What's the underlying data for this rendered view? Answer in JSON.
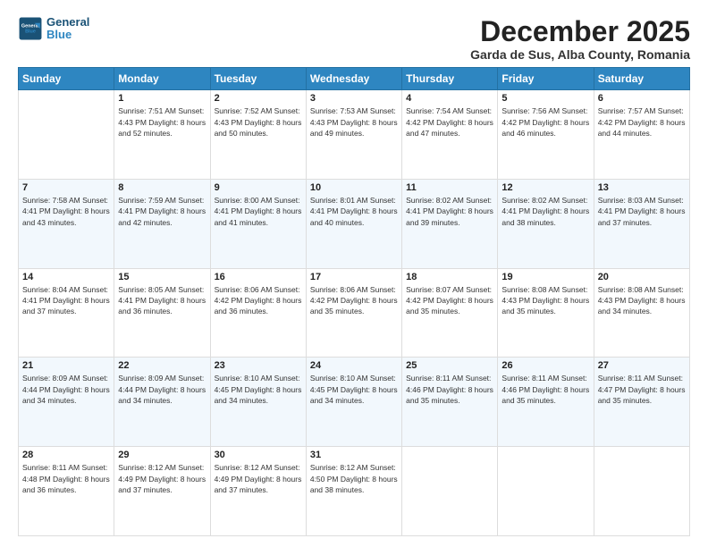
{
  "header": {
    "logo_line1": "General",
    "logo_line2": "Blue",
    "month": "December 2025",
    "location": "Garda de Sus, Alba County, Romania"
  },
  "weekdays": [
    "Sunday",
    "Monday",
    "Tuesday",
    "Wednesday",
    "Thursday",
    "Friday",
    "Saturday"
  ],
  "weeks": [
    [
      {
        "day": "",
        "info": ""
      },
      {
        "day": "1",
        "info": "Sunrise: 7:51 AM\nSunset: 4:43 PM\nDaylight: 8 hours\nand 52 minutes."
      },
      {
        "day": "2",
        "info": "Sunrise: 7:52 AM\nSunset: 4:43 PM\nDaylight: 8 hours\nand 50 minutes."
      },
      {
        "day": "3",
        "info": "Sunrise: 7:53 AM\nSunset: 4:43 PM\nDaylight: 8 hours\nand 49 minutes."
      },
      {
        "day": "4",
        "info": "Sunrise: 7:54 AM\nSunset: 4:42 PM\nDaylight: 8 hours\nand 47 minutes."
      },
      {
        "day": "5",
        "info": "Sunrise: 7:56 AM\nSunset: 4:42 PM\nDaylight: 8 hours\nand 46 minutes."
      },
      {
        "day": "6",
        "info": "Sunrise: 7:57 AM\nSunset: 4:42 PM\nDaylight: 8 hours\nand 44 minutes."
      }
    ],
    [
      {
        "day": "7",
        "info": "Sunrise: 7:58 AM\nSunset: 4:41 PM\nDaylight: 8 hours\nand 43 minutes."
      },
      {
        "day": "8",
        "info": "Sunrise: 7:59 AM\nSunset: 4:41 PM\nDaylight: 8 hours\nand 42 minutes."
      },
      {
        "day": "9",
        "info": "Sunrise: 8:00 AM\nSunset: 4:41 PM\nDaylight: 8 hours\nand 41 minutes."
      },
      {
        "day": "10",
        "info": "Sunrise: 8:01 AM\nSunset: 4:41 PM\nDaylight: 8 hours\nand 40 minutes."
      },
      {
        "day": "11",
        "info": "Sunrise: 8:02 AM\nSunset: 4:41 PM\nDaylight: 8 hours\nand 39 minutes."
      },
      {
        "day": "12",
        "info": "Sunrise: 8:02 AM\nSunset: 4:41 PM\nDaylight: 8 hours\nand 38 minutes."
      },
      {
        "day": "13",
        "info": "Sunrise: 8:03 AM\nSunset: 4:41 PM\nDaylight: 8 hours\nand 37 minutes."
      }
    ],
    [
      {
        "day": "14",
        "info": "Sunrise: 8:04 AM\nSunset: 4:41 PM\nDaylight: 8 hours\nand 37 minutes."
      },
      {
        "day": "15",
        "info": "Sunrise: 8:05 AM\nSunset: 4:41 PM\nDaylight: 8 hours\nand 36 minutes."
      },
      {
        "day": "16",
        "info": "Sunrise: 8:06 AM\nSunset: 4:42 PM\nDaylight: 8 hours\nand 36 minutes."
      },
      {
        "day": "17",
        "info": "Sunrise: 8:06 AM\nSunset: 4:42 PM\nDaylight: 8 hours\nand 35 minutes."
      },
      {
        "day": "18",
        "info": "Sunrise: 8:07 AM\nSunset: 4:42 PM\nDaylight: 8 hours\nand 35 minutes."
      },
      {
        "day": "19",
        "info": "Sunrise: 8:08 AM\nSunset: 4:43 PM\nDaylight: 8 hours\nand 35 minutes."
      },
      {
        "day": "20",
        "info": "Sunrise: 8:08 AM\nSunset: 4:43 PM\nDaylight: 8 hours\nand 34 minutes."
      }
    ],
    [
      {
        "day": "21",
        "info": "Sunrise: 8:09 AM\nSunset: 4:44 PM\nDaylight: 8 hours\nand 34 minutes."
      },
      {
        "day": "22",
        "info": "Sunrise: 8:09 AM\nSunset: 4:44 PM\nDaylight: 8 hours\nand 34 minutes."
      },
      {
        "day": "23",
        "info": "Sunrise: 8:10 AM\nSunset: 4:45 PM\nDaylight: 8 hours\nand 34 minutes."
      },
      {
        "day": "24",
        "info": "Sunrise: 8:10 AM\nSunset: 4:45 PM\nDaylight: 8 hours\nand 34 minutes."
      },
      {
        "day": "25",
        "info": "Sunrise: 8:11 AM\nSunset: 4:46 PM\nDaylight: 8 hours\nand 35 minutes."
      },
      {
        "day": "26",
        "info": "Sunrise: 8:11 AM\nSunset: 4:46 PM\nDaylight: 8 hours\nand 35 minutes."
      },
      {
        "day": "27",
        "info": "Sunrise: 8:11 AM\nSunset: 4:47 PM\nDaylight: 8 hours\nand 35 minutes."
      }
    ],
    [
      {
        "day": "28",
        "info": "Sunrise: 8:11 AM\nSunset: 4:48 PM\nDaylight: 8 hours\nand 36 minutes."
      },
      {
        "day": "29",
        "info": "Sunrise: 8:12 AM\nSunset: 4:49 PM\nDaylight: 8 hours\nand 37 minutes."
      },
      {
        "day": "30",
        "info": "Sunrise: 8:12 AM\nSunset: 4:49 PM\nDaylight: 8 hours\nand 37 minutes."
      },
      {
        "day": "31",
        "info": "Sunrise: 8:12 AM\nSunset: 4:50 PM\nDaylight: 8 hours\nand 38 minutes."
      },
      {
        "day": "",
        "info": ""
      },
      {
        "day": "",
        "info": ""
      },
      {
        "day": "",
        "info": ""
      }
    ]
  ]
}
